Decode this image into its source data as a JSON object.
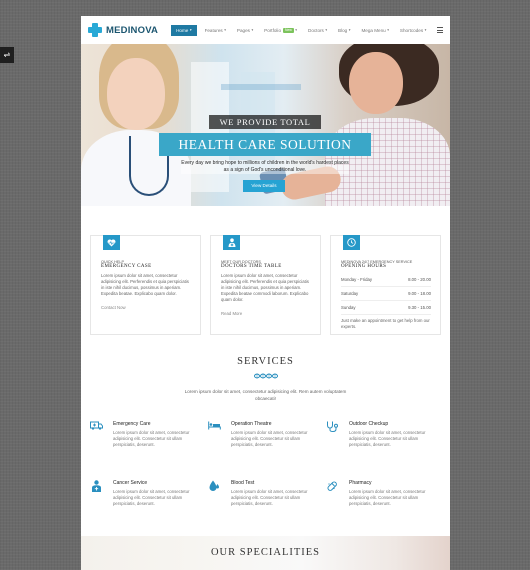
{
  "header": {
    "logo_text": "MEDINOVA",
    "nav": [
      {
        "label": "Home",
        "caret": "▾",
        "active": true
      },
      {
        "label": "Features",
        "caret": "▾"
      },
      {
        "label": "Pages",
        "caret": "▾"
      },
      {
        "label": "Portfolio",
        "badge": "New",
        "caret": "▾"
      },
      {
        "label": "Doctors",
        "caret": "▾"
      },
      {
        "label": "Blog",
        "caret": "▾"
      },
      {
        "label": "Mega Menu",
        "caret": "▾"
      },
      {
        "label": "Shortcodes",
        "caret": "▾"
      }
    ]
  },
  "hero": {
    "kicker": "WE PROVIDE TOTAL",
    "title": "HEALTH CARE SOLUTION",
    "text": "Every day we bring hope to millions of children in the world's hardest places as a sign of God's unconditional love.",
    "button": "View Details"
  },
  "info_boxes": [
    {
      "icon": "heart-pulse-icon",
      "kicker": "QUICK HELP",
      "title": "EMERGENCY CASE",
      "text": "Lorem ipsum dolor sit amet, consectetur adipisicing elit. Perferendis et quia perspiciatis in iste nihil ducimus, possimus in aperiam. Expedita beatae. Explicabo quam dolor.",
      "link": "Contact Now"
    },
    {
      "icon": "doctor-icon",
      "kicker": "MEET OUR DOCTORS",
      "title": "DOCTORS TIME TABLE",
      "text": "Lorem ipsum dolor sit amet, consectetur adipisicing elit. Perferendis et quia perspiciatis in iste nihil ducimus, possimus in aperiam. Expedita beatae commodi laborum. Explicabo quam dolor.",
      "link": "Read More"
    },
    {
      "icon": "clock-icon",
      "kicker": "MEDINOVA 24/7 EMERGENCY SERVICE",
      "title": "OPENING HOURS",
      "hours": [
        {
          "day": "Monday - Friday",
          "time": "8.00 - 20.00"
        },
        {
          "day": "Saturday",
          "time": "9.00 - 18.00"
        },
        {
          "day": "Sunday",
          "time": "9.30 - 15.00"
        }
      ],
      "note": "Just make an appointment to get help from our experts."
    }
  ],
  "services": {
    "title": "SERVICES",
    "intro": "Lorem ipsum dolor sit amet, consectetur adipisicing elit. Rem autem voluptatem obcaecati!",
    "items": [
      {
        "icon": "ambulance-icon",
        "title": "Emergency Care",
        "text": "Lorem ipsum dolor sit amet, consectetur adipisicing elit. Consectetur sit ullam perspiciatis, deserunt."
      },
      {
        "icon": "hospital-bed-icon",
        "title": "Operation Theatre",
        "text": "Lorem ipsum dolor sit amet, consectetur adipisicing elit. Consectetur sit ullam perspiciatis, deserunt."
      },
      {
        "icon": "stethoscope-icon",
        "title": "Outdoor Checkup",
        "text": "Lorem ipsum dolor sit amet, consectetur adipisicing elit. Consectetur sit ullam perspiciatis, deserunt."
      },
      {
        "icon": "patient-icon",
        "title": "Cancer Service",
        "text": "Lorem ipsum dolor sit amet, consectetur adipisicing elit. Consectetur sit ullam perspiciatis, deserunt."
      },
      {
        "icon": "blood-drop-icon",
        "title": "Blood Test",
        "text": "Lorem ipsum dolor sit amet, consectetur adipisicing elit. Consectetur sit ullam perspiciatis, deserunt."
      },
      {
        "icon": "pills-icon",
        "title": "Pharmacy",
        "text": "Lorem ipsum dolor sit amet, consectetur adipisicing elit. Consectetur sit ullam perspiciatis, deserunt."
      }
    ]
  },
  "specialities": {
    "title": "OUR SPECIALITIES"
  },
  "colors": {
    "accent": "#26a3d3",
    "nav_active": "#1f7aa3",
    "badge": "#7cc35c",
    "logo": "#1c5670"
  }
}
